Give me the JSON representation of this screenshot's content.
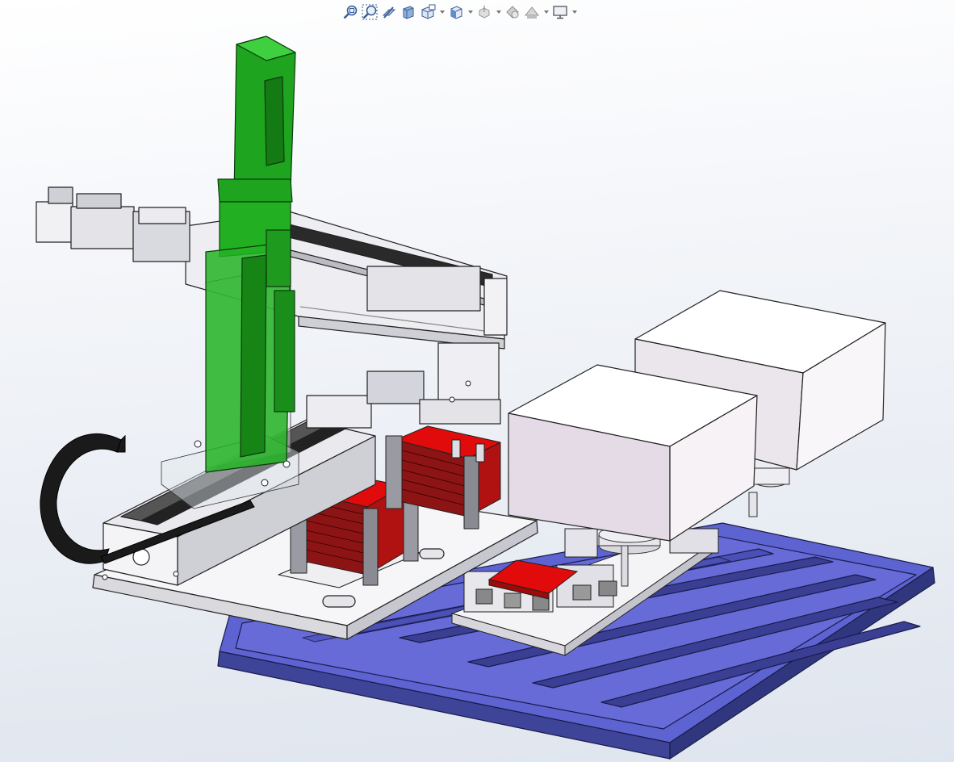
{
  "heads_up_toolbar": {
    "items": [
      {
        "id": "zoom-to-fit",
        "icon": "zoom-to-fit-icon"
      },
      {
        "id": "zoom-to-area",
        "icon": "zoom-to-area-icon"
      },
      {
        "id": "previous-view",
        "icon": "previous-view-icon"
      },
      {
        "id": "section-view",
        "icon": "section-view-icon"
      },
      {
        "id": "dynamic-annotation-views",
        "icon": "dynamic-annotation-views-icon"
      },
      {
        "id": "view-orientation",
        "icon": "view-orientation-icon",
        "dropdown": true
      },
      {
        "id": "display-style",
        "icon": "display-style-icon",
        "dropdown": true
      },
      {
        "id": "hide-show-items",
        "icon": "hide-show-items-icon",
        "dropdown": true
      },
      {
        "id": "edit-appearance",
        "icon": "edit-appearance-icon"
      },
      {
        "id": "apply-scene",
        "icon": "apply-scene-icon",
        "dropdown": true
      },
      {
        "id": "view-settings",
        "icon": "view-settings-icon",
        "dropdown": true
      }
    ]
  },
  "colors": {
    "background_top": "#ffffff",
    "background_bottom": "#dfe5ee",
    "z_axis_green": "#1fa41f",
    "pallet_blue": "#5d63d1",
    "parts_red": "#e10b0b",
    "cable_chain": "#1a1a1a",
    "box_lavender": "#f6f1f6"
  }
}
